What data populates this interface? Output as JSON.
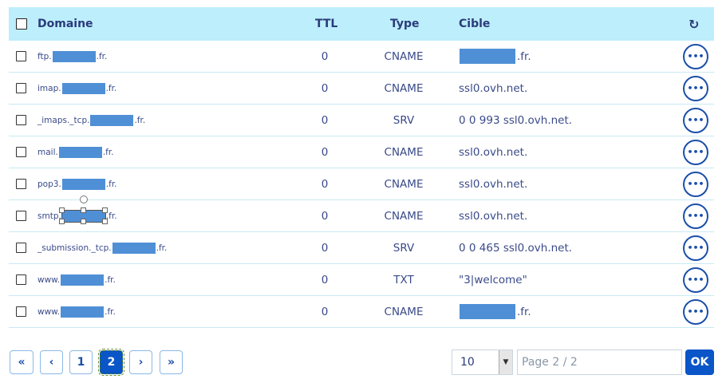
{
  "header": {
    "domain": "Domaine",
    "ttl": "TTL",
    "type": "Type",
    "cible": "Cible",
    "refresh_icon": "refresh-icon"
  },
  "rows": [
    {
      "domain_prefix": "ftp.",
      "domain_suffix": ".fr.",
      "ttl": "0",
      "type": "CNAME",
      "cible_text": ".fr.",
      "cible_redacted": true
    },
    {
      "domain_prefix": "imap.",
      "domain_suffix": ".fr.",
      "ttl": "0",
      "type": "CNAME",
      "cible_text": "ssl0.ovh.net.",
      "cible_redacted": false
    },
    {
      "domain_prefix": "_imaps._tcp.",
      "domain_suffix": ".fr.",
      "ttl": "0",
      "type": "SRV",
      "cible_text": "0 0 993 ssl0.ovh.net.",
      "cible_redacted": false
    },
    {
      "domain_prefix": "mail.",
      "domain_suffix": ".fr.",
      "ttl": "0",
      "type": "CNAME",
      "cible_text": "ssl0.ovh.net.",
      "cible_redacted": false
    },
    {
      "domain_prefix": "pop3.",
      "domain_suffix": ".fr.",
      "ttl": "0",
      "type": "CNAME",
      "cible_text": "ssl0.ovh.net.",
      "cible_redacted": false
    },
    {
      "domain_prefix": "smtp.",
      "domain_suffix": ".fr.",
      "ttl": "0",
      "type": "CNAME",
      "cible_text": "ssl0.ovh.net.",
      "cible_redacted": false
    },
    {
      "domain_prefix": "_submission._tcp.",
      "domain_suffix": ".fr.",
      "ttl": "0",
      "type": "SRV",
      "cible_text": "0 0 465 ssl0.ovh.net.",
      "cible_redacted": false
    },
    {
      "domain_prefix": "www.",
      "domain_suffix": ".fr.",
      "ttl": "0",
      "type": "TXT",
      "cible_text": "\"3|welcome\"",
      "cible_redacted": false
    },
    {
      "domain_prefix": "www.",
      "domain_suffix": ".fr.",
      "ttl": "0",
      "type": "CNAME",
      "cible_text": ".fr.",
      "cible_redacted": true
    }
  ],
  "action_label": "•••",
  "pagination": {
    "first": "«",
    "prev": "‹",
    "page1": "1",
    "page2": "2",
    "next": "›",
    "last": "»",
    "page_size": "10",
    "page_placeholder": "Page 2 / 2",
    "ok": "OK"
  },
  "colors": {
    "header_bg": "#bdeefc",
    "accent": "#0a55c8",
    "redaction": "#4f8fd6"
  }
}
